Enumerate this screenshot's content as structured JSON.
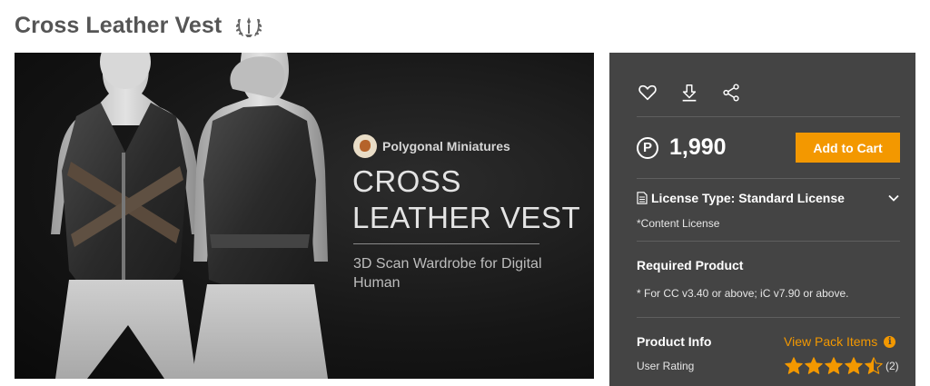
{
  "product": {
    "title": "Cross Leather Vest",
    "badge_icon": "laurel-icon"
  },
  "banner": {
    "brand": "Polygonal Miniatures",
    "title": "CROSS LEATHER VEST",
    "subtitle": "3D Scan Wardrobe for Digital Human"
  },
  "actions": {
    "icons": [
      "heart-icon",
      "download-icon",
      "share-icon"
    ]
  },
  "purchase": {
    "currency_symbol": "P",
    "price": "1,990",
    "add_to_cart": "Add to Cart"
  },
  "license": {
    "type_label": "License Type: Standard License",
    "note": "*Content License"
  },
  "required": {
    "title": "Required Product",
    "text": "* For CC v3.40 or above; iC v7.90 or above."
  },
  "info": {
    "title": "Product Info",
    "view_pack": "View Pack Items",
    "rating_label": "User Rating",
    "rating": 4.5,
    "rating_max": 5,
    "rating_count": "(2)"
  },
  "colors": {
    "accent": "#f39800",
    "panel_bg": "#444444",
    "title_text": "#555555"
  }
}
